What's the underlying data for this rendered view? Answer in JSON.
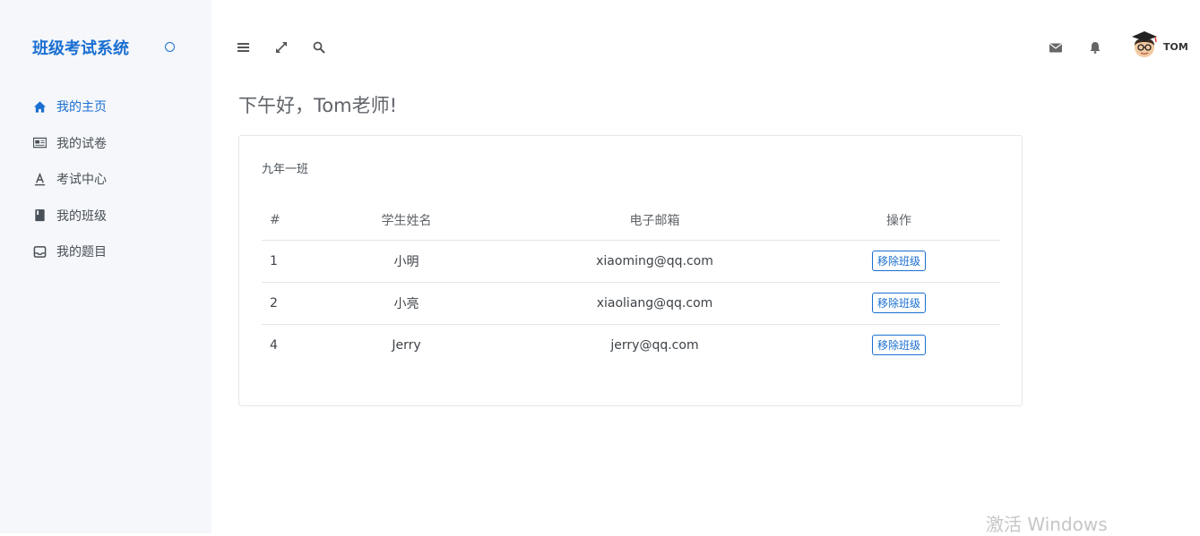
{
  "app": {
    "brand": "班级考试系统",
    "brand_toggle_icon": "circle-icon",
    "accent": "#1a6fd1"
  },
  "sidebar": {
    "items": [
      {
        "label": "我的主页",
        "icon": "home-icon",
        "active": true
      },
      {
        "label": "我的试卷",
        "icon": "newspaper-icon",
        "active": false
      },
      {
        "label": "考试中心",
        "icon": "font-icon",
        "active": false
      },
      {
        "label": "我的班级",
        "icon": "book-icon",
        "active": false
      },
      {
        "label": "我的题目",
        "icon": "inbox-icon",
        "active": false
      }
    ]
  },
  "topbar": {
    "left_icons": [
      "menu-icon",
      "expand-icon",
      "search-icon"
    ],
    "right_icons": [
      "mail-icon",
      "bell-icon"
    ],
    "user": {
      "name": "TOM",
      "avatar": "teacher-avatar"
    }
  },
  "main": {
    "greeting": "下午好，Tom老师!",
    "class_card": {
      "title": "九年一班",
      "columns": [
        "#",
        "学生姓名",
        "电子邮箱",
        "操作"
      ],
      "rows": [
        {
          "id": "1",
          "name": "小明",
          "email": "xiaoming@qq.com",
          "action": "移除班级"
        },
        {
          "id": "2",
          "name": "小亮",
          "email": "xiaoliang@qq.com",
          "action": "移除班级"
        },
        {
          "id": "4",
          "name": "Jerry",
          "email": "jerry@qq.com",
          "action": "移除班级"
        }
      ]
    }
  },
  "watermark": "激活 Windows"
}
